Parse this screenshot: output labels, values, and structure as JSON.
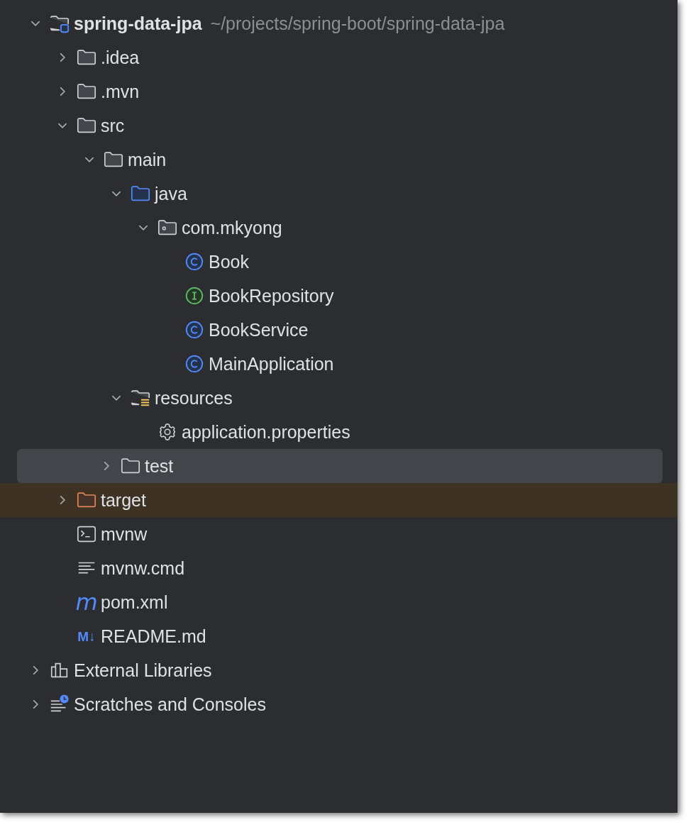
{
  "project_tree": [
    {
      "name": "spring-data-jpa",
      "path": "~/projects/spring-boot/spring-data-jpa",
      "kind": "module",
      "expanded": true,
      "selected": false,
      "children": [
        {
          "name": ".idea",
          "kind": "folder",
          "expanded": false,
          "selected": false
        },
        {
          "name": ".mvn",
          "kind": "folder",
          "expanded": false,
          "selected": false
        },
        {
          "name": "src",
          "kind": "folder",
          "expanded": true,
          "selected": false,
          "children": [
            {
              "name": "main",
              "kind": "folder",
              "expanded": true,
              "selected": false,
              "children": [
                {
                  "name": "java",
                  "kind": "source-folder",
                  "expanded": true,
                  "selected": false,
                  "children": [
                    {
                      "name": "com.mkyong",
                      "kind": "package",
                      "expanded": true,
                      "selected": false,
                      "children": [
                        {
                          "name": "Book",
                          "kind": "class",
                          "selected": false
                        },
                        {
                          "name": "BookRepository",
                          "kind": "interface",
                          "selected": false
                        },
                        {
                          "name": "BookService",
                          "kind": "class",
                          "selected": false
                        },
                        {
                          "name": "MainApplication",
                          "kind": "class",
                          "selected": false
                        }
                      ]
                    }
                  ]
                },
                {
                  "name": "resources",
                  "kind": "resources-folder",
                  "expanded": true,
                  "selected": false,
                  "children": [
                    {
                      "name": "application.properties",
                      "kind": "settings",
                      "selected": false
                    }
                  ]
                }
              ]
            },
            {
              "name": "test",
              "kind": "folder",
              "expanded": false,
              "selected": true
            }
          ]
        },
        {
          "name": "target",
          "kind": "excluded-folder",
          "expanded": false,
          "selected": false
        },
        {
          "name": "mvnw",
          "kind": "shell",
          "selected": false
        },
        {
          "name": "mvnw.cmd",
          "kind": "text",
          "selected": false
        },
        {
          "name": "pom.xml",
          "kind": "maven",
          "icon_text": "m",
          "selected": false
        },
        {
          "name": "README.md",
          "kind": "markdown",
          "icon_text": "M↓",
          "selected": false
        }
      ]
    },
    {
      "name": "External Libraries",
      "kind": "libraries",
      "expanded": false,
      "selected": false
    },
    {
      "name": "Scratches and Consoles",
      "kind": "scratches",
      "expanded": false,
      "selected": false
    }
  ]
}
